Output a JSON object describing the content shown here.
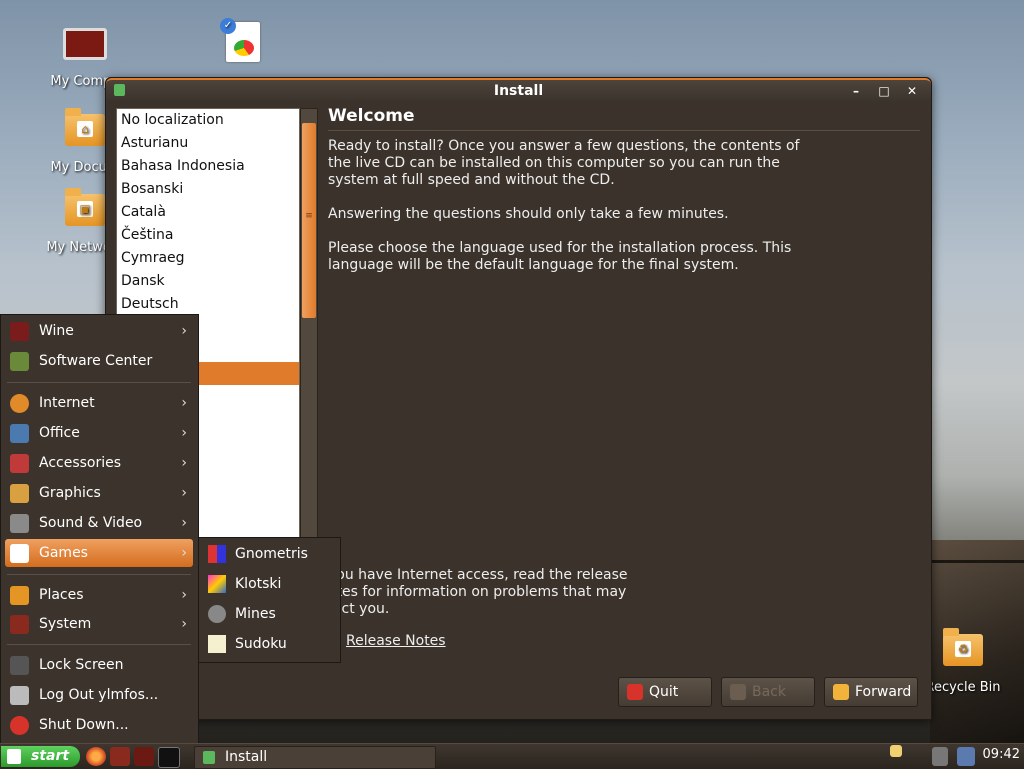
{
  "desktop": {
    "icons": [
      {
        "label": "My Compu"
      },
      {
        "label": "My Docum"
      },
      {
        "label": "My Network"
      },
      {
        "label": "Recycle Bin"
      }
    ]
  },
  "window": {
    "title": "Install",
    "controls": {
      "minimize": "–",
      "maximize": "□",
      "close": "✕"
    }
  },
  "languages": [
    "No localization",
    "Asturianu",
    "Bahasa Indonesia",
    "Bosanski",
    "Català",
    "Čeština",
    "Cymraeg",
    "Dansk",
    "Deutsch"
  ],
  "welcome": {
    "title": "Welcome",
    "para1": "Ready to install? Once you answer a few questions, the contents of the live CD can be installed on this computer so you can run the system at full speed and without the CD.",
    "para2": "Answering the questions should only take a few minutes.",
    "para3": "Please choose the language used for the installation process. This language will be the default language for the final system.",
    "release_text": "you have Internet access, read the release otes for information on problems that may fect you.",
    "release_link": "Release Notes"
  },
  "buttons": {
    "quit": "Quit",
    "back": "Back",
    "forward": "Forward"
  },
  "startmenu": {
    "items": [
      {
        "label": "Wine",
        "arrow": "›"
      },
      {
        "label": "Software Center"
      },
      {
        "label": "Internet",
        "arrow": "›"
      },
      {
        "label": "Office",
        "arrow": "›"
      },
      {
        "label": "Accessories",
        "arrow": "›"
      },
      {
        "label": "Graphics",
        "arrow": "›"
      },
      {
        "label": "Sound & Video",
        "arrow": "›"
      },
      {
        "label": "Games",
        "arrow": "›"
      },
      {
        "label": "Places",
        "arrow": "›"
      },
      {
        "label": "System",
        "arrow": "›"
      },
      {
        "label": "Lock Screen"
      },
      {
        "label": "Log Out ylmfos..."
      },
      {
        "label": "Shut Down..."
      }
    ]
  },
  "games_submenu": [
    "Gnometris",
    "Klotski",
    "Mines",
    "Sudoku"
  ],
  "taskbar": {
    "start_label": "start",
    "task_label": "Install",
    "clock": "09:42"
  },
  "colors": {
    "accent": "#e07b2c",
    "panel": "#3c342c"
  }
}
